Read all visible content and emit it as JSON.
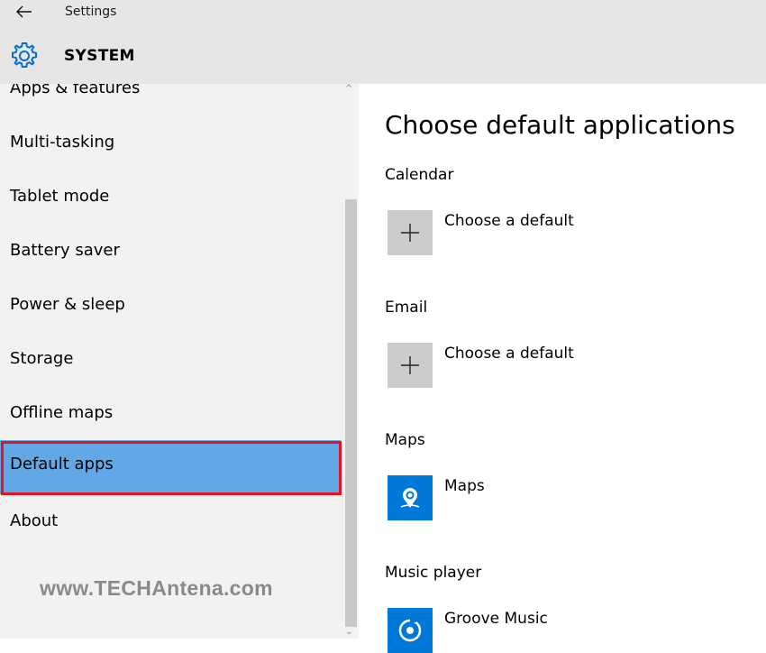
{
  "window": {
    "title": "Settings",
    "section": "SYSTEM"
  },
  "sidebar": {
    "items": [
      {
        "label": "Apps & features"
      },
      {
        "label": "Multi-tasking"
      },
      {
        "label": "Tablet mode"
      },
      {
        "label": "Battery saver"
      },
      {
        "label": "Power & sleep"
      },
      {
        "label": "Storage"
      },
      {
        "label": "Offline maps"
      },
      {
        "label": "Default apps",
        "selected": true
      },
      {
        "label": "About"
      }
    ]
  },
  "watermark": "www.TECHAntena.com",
  "main": {
    "title": "Choose default applications",
    "defaults": [
      {
        "category": "Calendar",
        "app": "Choose a default",
        "icon": "plus-icon"
      },
      {
        "category": "Email",
        "app": "Choose a default",
        "icon": "plus-icon"
      },
      {
        "category": "Maps",
        "app": "Maps",
        "icon": "maps-icon"
      },
      {
        "category": "Music player",
        "app": "Groove Music",
        "icon": "groove-music-icon"
      }
    ]
  },
  "colors": {
    "selected_item": "#62a8e4",
    "highlight_border": "#e81123",
    "app_tile_blue": "#0078d7",
    "placeholder_tile": "#cccccc"
  }
}
